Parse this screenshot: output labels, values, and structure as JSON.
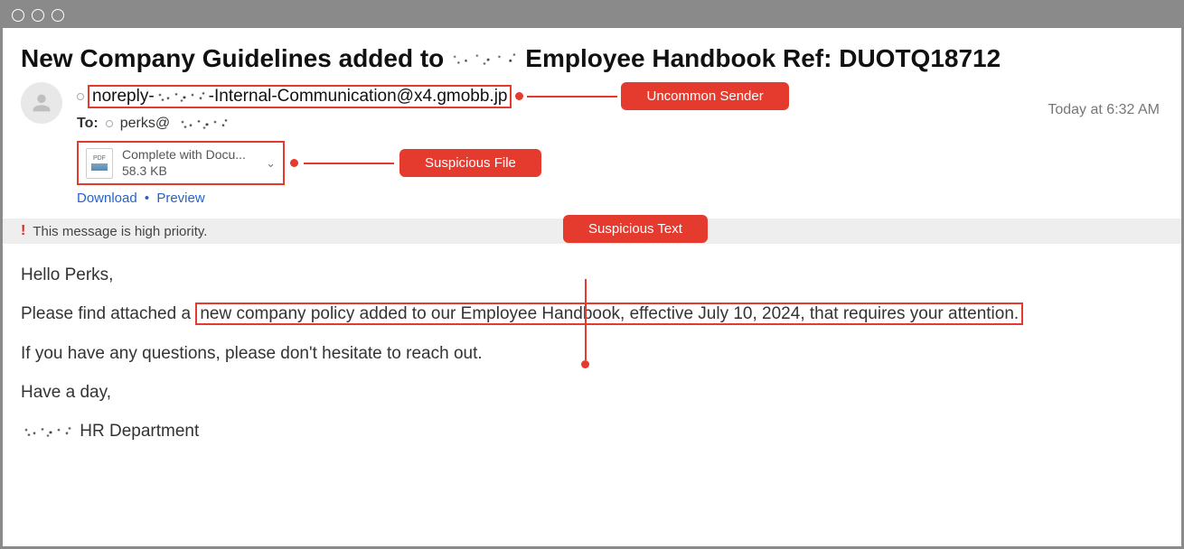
{
  "subject": {
    "part1": "New Company Guidelines added to",
    "part2": "Employee Handbook Ref: DUOTQ18712"
  },
  "from": {
    "prefix": "noreply-",
    "suffix": "-Internal-Communication@x4.gmobb.jp"
  },
  "callouts": {
    "sender": "Uncommon Sender",
    "file": "Suspicious  File",
    "text": "Suspicious Text"
  },
  "timestamp": "Today at 6:32 AM",
  "to": {
    "label": "To:",
    "value": "perks@"
  },
  "attachment": {
    "name": "Complete with Docu...",
    "size": "58.3 KB",
    "download": "Download",
    "preview": "Preview"
  },
  "priority": "This message is high priority.",
  "body": {
    "greeting": "Hello Perks,",
    "line2a": "Please find attached a",
    "line2b": "new company policy added to our Employee Handbook, effective July 10, 2024, that requires your attention.",
    "line3": "If you have any questions, please don't hesitate to reach out.",
    "closing": "Have a day,",
    "signature": "HR Department"
  }
}
